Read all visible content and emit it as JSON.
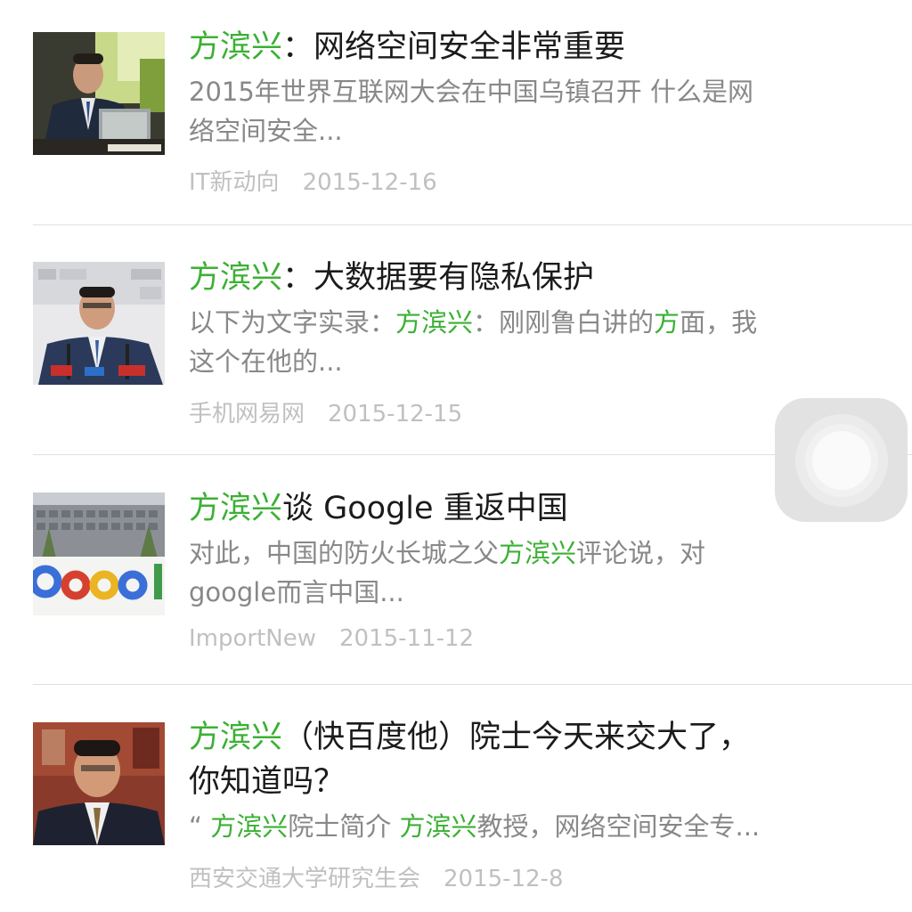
{
  "articles": [
    {
      "title_hl": "方滨兴",
      "title_rest": "：网络空间安全非常重要",
      "snippet_line1": "2015年世界互联网大会在中国乌镇召开 什么是网",
      "snippet_line2": "络空间安全...",
      "source": "IT新动向",
      "date": "2015-12-16",
      "thumb_icon": "speaker-at-podium-photo"
    },
    {
      "title_hl": "方滨兴",
      "title_rest": "：大数据要有隐私保护",
      "snippet_a": "以下为文字实录：",
      "snippet_hl": "方滨兴",
      "snippet_b": "：刚刚鲁白讲的",
      "snippet_hl2": "方",
      "snippet_c": "面，我",
      "snippet_line2": "这个在他的...",
      "source": "手机网易网",
      "date": "2015-12-15",
      "thumb_icon": "speaker-with-microphones-photo"
    },
    {
      "title_hl": "方滨兴",
      "title_rest": "谈 Google 重返中国",
      "snippet_a": "对此，中国的防火长城之父",
      "snippet_hl": "方滨兴",
      "snippet_b": "评论说，对",
      "snippet_line2": "google而言中国...",
      "source": "ImportNew",
      "date": "2015-11-12",
      "thumb_icon": "google-building-photo"
    },
    {
      "title_hl": "方滨兴",
      "title_rest": "（快百度他）院士今天来交大了，",
      "title_line2": "你知道吗？",
      "snippet_a": "“ ",
      "snippet_hl": "方滨兴",
      "snippet_b": "院士简介 ",
      "snippet_hl2": "方滨兴",
      "snippet_c": "教授，网络空间安全专...",
      "source": "西安交通大学研究生会",
      "date": "2015-12-8",
      "thumb_icon": "portrait-photo"
    }
  ],
  "assistive_touch": {
    "icon": "assistive-touch-icon"
  },
  "colors": {
    "highlight": "#3cb034",
    "title": "#1b1b1b",
    "snippet": "#888888",
    "meta": "#c0c0c0"
  }
}
